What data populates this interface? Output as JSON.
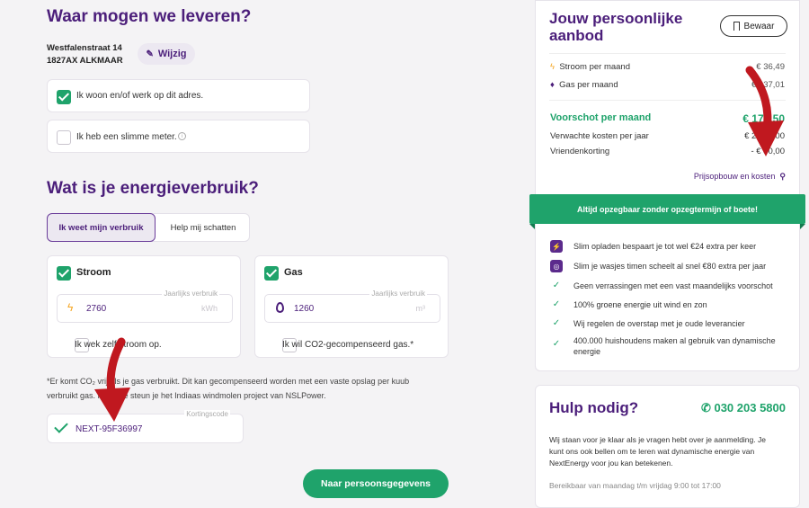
{
  "delivery": {
    "title": "Waar mogen we leveren?",
    "street": "Westfalenstraat 14",
    "postal": "1827AX ALKMAAR",
    "edit_label": "Wijzig",
    "live_work_label": "Ik woon en/of werk op dit adres.",
    "smart_meter_label": "Ik heb een slimme meter."
  },
  "usage": {
    "title": "Wat is je energieverbruik?",
    "tabs": [
      "Ik weet mijn verbruik",
      "Help mij schatten"
    ],
    "stroom": {
      "label": "Stroom",
      "field_label": "Jaarlijks verbruik",
      "value": "2760",
      "unit": "kWh",
      "produce_label": "Ik wek zelf stroom op."
    },
    "gas": {
      "label": "Gas",
      "field_label": "Jaarlijks verbruik",
      "value": "1260",
      "unit": "m³",
      "co2_label": "Ik wil CO2-gecompenseerd gas.*"
    },
    "footnote_line1": "*Er komt CO₂ vrij als je gas verbruikt. Dit kan gecompenseerd worden met een vaste opslag per kuub",
    "footnote_line2": "verbruikt gas. Hiermee steun je het Indiaas windmolen project van NSLPower.",
    "discount": {
      "label": "Kortingscode",
      "value": "NEXT-95F36997"
    },
    "next_button": "Naar persoonsgegevens"
  },
  "offer": {
    "title_line1": "Jouw persoonlijke",
    "title_line2": "aanbod",
    "save_button": "Bewaar",
    "stroom_label": "Stroom per maand",
    "stroom_value": "€ 36,49",
    "gas_label": "Gas per maand",
    "gas_value": "€ 137,01",
    "advance_label": "Voorschot per maand",
    "advance_value": "€ 173,50",
    "yearly_label": "Verwachte kosten per jaar",
    "yearly_value": "€ 2.082,00",
    "friend_label": "Vriendenkorting",
    "friend_value": "- € 50,00",
    "price_link": "Prijsopbouw en kosten",
    "banner": "Altijd opzegbaar zonder opzegtermijn of boete!",
    "features": [
      {
        "icon": "charging-icon",
        "text": "Slim opladen bespaart je tot wel €24 extra per keer"
      },
      {
        "icon": "washer-icon",
        "text": "Slim je wasjes timen scheelt al snel €80 extra per jaar"
      },
      {
        "icon": "check-icon",
        "text": "Geen verrassingen met een vast maandelijks voorschot"
      },
      {
        "icon": "check-icon",
        "text": "100% groene energie uit wind en zon"
      },
      {
        "icon": "check-icon",
        "text": "Wij regelen de overstap met je oude leverancier"
      },
      {
        "icon": "check-icon",
        "text": "400.000 huishoudens maken al gebruik van dynamische"
      },
      {
        "icon": "",
        "text": "energie"
      }
    ]
  },
  "help": {
    "title": "Hulp nodig?",
    "phone": "030 203 5800",
    "body1": "Wij staan voor je klaar als je vragen hebt over je aanmelding. Je",
    "body2": "kunt ons ook bellen om te leren wat dynamische energie van",
    "body3": "NextEnergy voor jou kan betekenen.",
    "hours": "Bereikbaar van maandag t/m vrijdag 9:00 tot 17:00"
  },
  "colors": {
    "purple": "#4b1e7a",
    "green": "#1fa36b",
    "annotation_red": "#c0181f"
  }
}
